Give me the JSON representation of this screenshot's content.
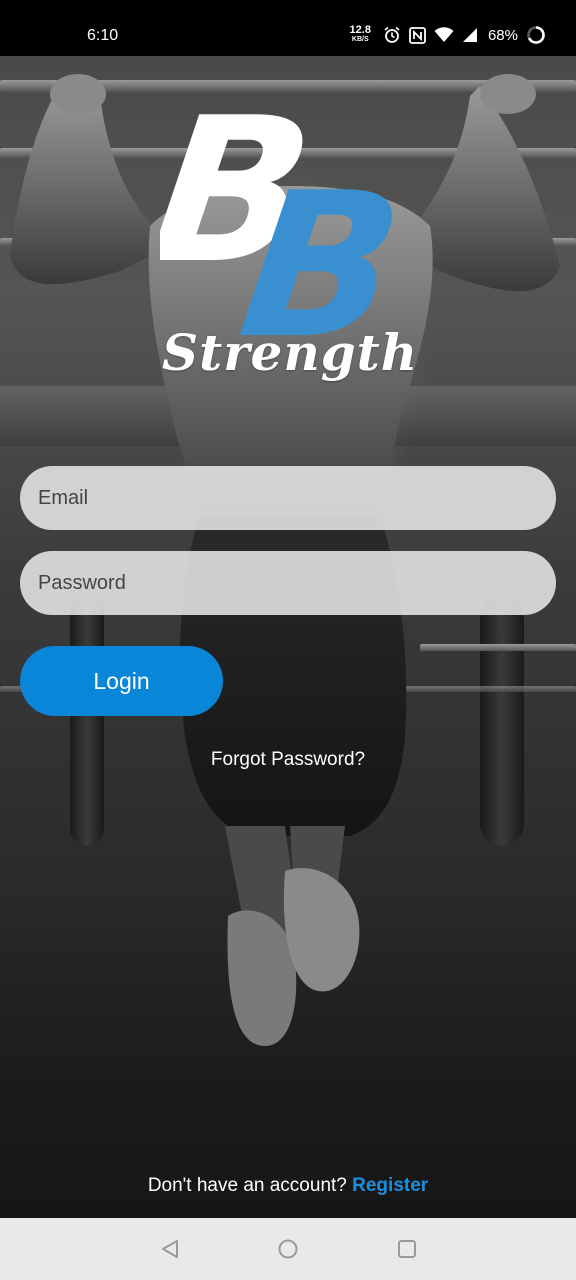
{
  "status_bar": {
    "time": "6:10",
    "net_speed_value": "12.8",
    "net_speed_unit": "KB/S",
    "battery": "68%",
    "icons": [
      "alarm-icon",
      "nfc-icon",
      "wifi-icon",
      "signal-icon",
      "battery-icon"
    ]
  },
  "logo": {
    "letters": "BB",
    "tagline": "Strength",
    "colors": {
      "first_b": "#ffffff",
      "second_b": "#3a8fd0"
    }
  },
  "form": {
    "email_placeholder": "Email",
    "email_value": "",
    "password_placeholder": "Password",
    "password_value": ""
  },
  "actions": {
    "login_label": "Login",
    "forgot_label": "Forgot Password?",
    "no_account_text": "Don't have an account? ",
    "register_label": "Register"
  },
  "colors": {
    "accent": "#0a86d8",
    "link": "#1a8fe0",
    "nav_bar": "#e9e9e9"
  },
  "nav_bar": {
    "buttons": [
      "back-icon",
      "home-icon",
      "recents-icon"
    ]
  }
}
